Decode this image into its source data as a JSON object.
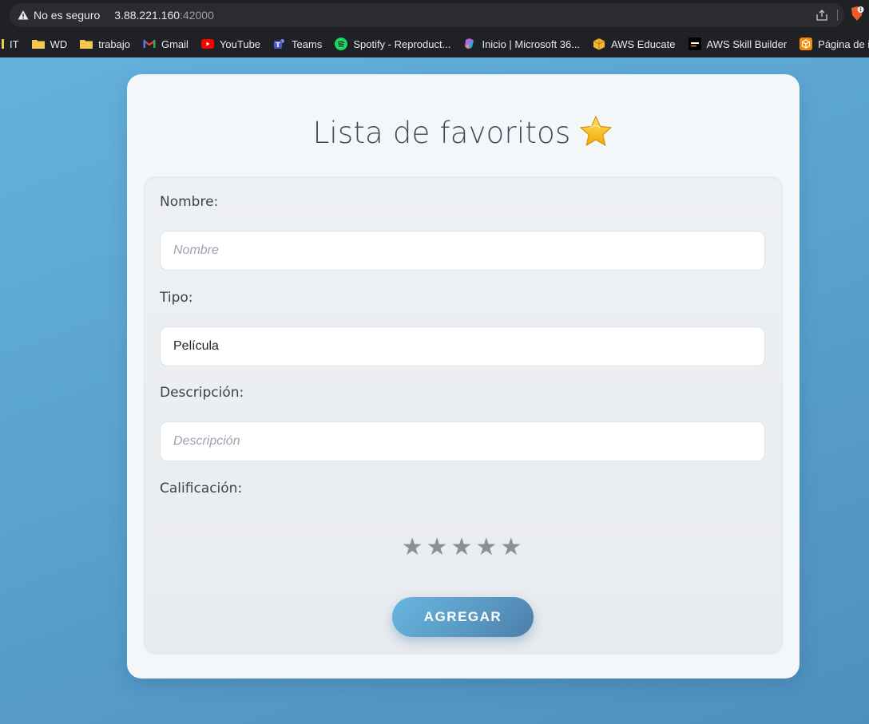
{
  "browser": {
    "security_label": "No es seguro",
    "url_host": "3.88.221.160",
    "url_port": ":42000",
    "bookmarks": [
      {
        "label": "IT",
        "icon": "folder-icon"
      },
      {
        "label": "WD",
        "icon": "folder-icon"
      },
      {
        "label": "trabajo",
        "icon": "folder-icon"
      },
      {
        "label": "Gmail",
        "icon": "gmail-icon"
      },
      {
        "label": "YouTube",
        "icon": "youtube-icon"
      },
      {
        "label": "Teams",
        "icon": "teams-icon"
      },
      {
        "label": "Spotify - Reproduct...",
        "icon": "spotify-icon"
      },
      {
        "label": "Inicio | Microsoft 36...",
        "icon": "microsoft365-icon"
      },
      {
        "label": "AWS Educate",
        "icon": "aws-educate-icon"
      },
      {
        "label": "AWS Skill Builder",
        "icon": "aws-skillbuilder-icon"
      },
      {
        "label": "Página de inicio de l...",
        "icon": "aws-box-icon"
      }
    ]
  },
  "page": {
    "title": "Lista de favoritos"
  },
  "form": {
    "nombre": {
      "label": "Nombre:",
      "placeholder": "Nombre",
      "value": ""
    },
    "tipo": {
      "label": "Tipo:",
      "value": "Película"
    },
    "descripcion": {
      "label": "Descripción:",
      "placeholder": "Descripción",
      "value": ""
    },
    "calificacion": {
      "label": "Calificación:",
      "stars": "★★★★★",
      "value": 0,
      "max": 5
    },
    "submit_label": "AGREGAR"
  },
  "colors": {
    "accent": "#5a9ac4",
    "background": "#5aa2d0",
    "star": "#8a9096"
  }
}
